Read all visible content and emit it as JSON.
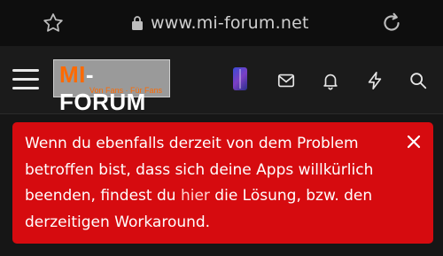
{
  "browser": {
    "url": "www.mi-forum.net",
    "icons": {
      "favorite": "star-icon",
      "secure": "lock-icon",
      "reload": "reload-icon"
    }
  },
  "header": {
    "logo": {
      "text_mi": "MI",
      "text_forum": "-FORUM",
      "tagline": "Von Fans · Für Fans"
    },
    "icons": [
      "menu-icon",
      "device-thumbnail",
      "mail-icon",
      "bell-icon",
      "lightning-icon",
      "search-icon"
    ]
  },
  "alert": {
    "text_before_link": "Wenn du ebenfalls derzeit von dem Problem betroffen bist, dass sich deine Apps willkürlich beenden, findest du ",
    "link_text": "hier",
    "text_after_link": " die Lösung, bzw. den derzeitigen Workaround.",
    "close_label": "×",
    "background_color": "#d60b0f"
  }
}
